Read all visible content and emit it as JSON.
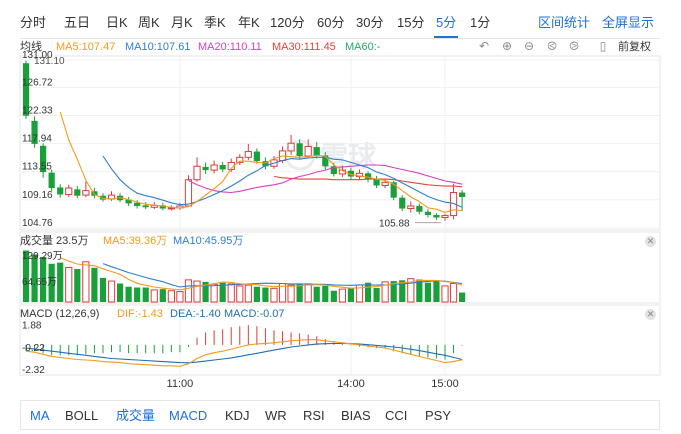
{
  "tabs": [
    "分时",
    "五日",
    "日K",
    "周K",
    "月K",
    "季K",
    "年K",
    "120分",
    "60分",
    "30分",
    "15分",
    "5分",
    "1分"
  ],
  "active_tab": "5分",
  "tools": {
    "range_stats": "区间统计",
    "fullscreen": "全屏显示"
  },
  "ma_legend": {
    "name": "均线",
    "ma5": "MA5:107.47",
    "ma10": "MA10:107.61",
    "ma20": "MA20:110.11",
    "ma30": "MA30:111.45",
    "ma60": "MA60:-"
  },
  "restore_label": "前复权",
  "watermark": "雪球",
  "colors": {
    "up": "#e23a3a",
    "down": "#1aa03a",
    "ma5": "#f29b1b",
    "ma10": "#2f7fcf",
    "ma20": "#d93cc7",
    "ma30": "#e6433b",
    "ma60": "#28a86a",
    "accent": "#1e6fd9",
    "dif": "#f29b1b",
    "dea": "#1f6fb7"
  },
  "chart_data": [
    {
      "type": "candlestick",
      "name": "price",
      "y_ticks": [
        "131.00",
        "126.72",
        "122.33",
        "117.94",
        "113.55",
        "109.16",
        "104.76"
      ],
      "y_tick_values": [
        131.0,
        126.72,
        122.33,
        117.94,
        113.55,
        109.16,
        104.76
      ],
      "ylim": [
        104.76,
        131.0
      ],
      "low_label": "105.88",
      "high_label_overlay": "131.10",
      "candles": [
        [
          130.5,
          122.3,
          130.9,
          121.8
        ],
        [
          121.5,
          117.9,
          122.2,
          117.3
        ],
        [
          117.6,
          113.5,
          118.0,
          112.6
        ],
        [
          113.4,
          111.0,
          113.9,
          110.5
        ],
        [
          111.1,
          110.0,
          111.6,
          109.5
        ],
        [
          110.0,
          111.0,
          111.5,
          109.6
        ],
        [
          110.8,
          109.8,
          111.3,
          109.4
        ],
        [
          109.9,
          110.6,
          112.0,
          109.6
        ],
        [
          110.5,
          109.8,
          111.0,
          109.4
        ],
        [
          109.8,
          109.2,
          110.2,
          108.9
        ],
        [
          109.3,
          109.9,
          110.5,
          109.0
        ],
        [
          109.8,
          109.1,
          110.2,
          108.8
        ],
        [
          109.2,
          108.6,
          109.6,
          108.2
        ],
        [
          108.7,
          108.2,
          109.1,
          107.8
        ],
        [
          108.3,
          108.0,
          108.8,
          107.7
        ],
        [
          108.0,
          108.3,
          108.8,
          107.7
        ],
        [
          108.3,
          107.8,
          108.7,
          107.5
        ],
        [
          107.9,
          107.9,
          108.3,
          107.5
        ],
        [
          107.9,
          108.2,
          108.7,
          107.6
        ],
        [
          108.2,
          112.3,
          113.0,
          108.0
        ],
        [
          112.3,
          114.4,
          115.8,
          112.0
        ],
        [
          114.3,
          113.8,
          115.0,
          113.2
        ],
        [
          113.8,
          114.6,
          115.3,
          113.3
        ],
        [
          114.6,
          113.9,
          115.1,
          113.5
        ],
        [
          113.9,
          115.0,
          115.6,
          113.5
        ],
        [
          115.0,
          115.8,
          116.3,
          114.6
        ],
        [
          115.8,
          116.7,
          117.9,
          115.4
        ],
        [
          116.7,
          115.2,
          117.2,
          114.8
        ],
        [
          115.2,
          114.4,
          115.8,
          113.9
        ],
        [
          114.4,
          115.4,
          116.0,
          114.0
        ],
        [
          115.3,
          116.8,
          117.5,
          114.9
        ],
        [
          116.8,
          118.0,
          119.3,
          116.2
        ],
        [
          118.0,
          116.0,
          118.6,
          115.5
        ],
        [
          116.0,
          117.5,
          118.6,
          115.7
        ],
        [
          117.4,
          116.1,
          118.2,
          115.6
        ],
        [
          116.1,
          114.4,
          116.6,
          113.9
        ],
        [
          114.4,
          113.2,
          114.9,
          112.8
        ],
        [
          113.2,
          113.8,
          114.5,
          112.7
        ],
        [
          113.7,
          112.8,
          114.2,
          112.4
        ],
        [
          112.8,
          113.3,
          113.9,
          112.3
        ],
        [
          113.3,
          112.4,
          113.6,
          111.9
        ],
        [
          112.4,
          111.4,
          112.9,
          111.0
        ],
        [
          111.4,
          111.9,
          112.5,
          111.0
        ],
        [
          111.9,
          109.5,
          112.1,
          109.1
        ],
        [
          109.5,
          107.8,
          109.9,
          107.4
        ],
        [
          107.8,
          108.2,
          108.9,
          107.2
        ],
        [
          108.2,
          107.3,
          108.6,
          106.9
        ],
        [
          107.3,
          106.8,
          107.7,
          106.4
        ],
        [
          106.8,
          106.4,
          107.1,
          106.0
        ],
        [
          106.4,
          106.7,
          107.0,
          105.9
        ],
        [
          106.7,
          110.3,
          111.7,
          106.1
        ],
        [
          110.3,
          109.6,
          110.7,
          107.4
        ]
      ],
      "ma5": [
        null,
        null,
        null,
        null,
        122.9,
        118.5,
        115.5,
        112.2,
        110.0,
        109.4,
        109.3,
        109.5,
        109.2,
        108.8,
        108.5,
        108.3,
        108.2,
        108.0,
        107.9,
        108.1,
        108.9,
        109.9,
        110.9,
        112.0,
        114.1,
        115.2,
        115.2,
        115.0,
        114.9,
        115.6,
        116.0,
        115.9,
        115.8,
        115.9,
        116.1,
        116.0,
        114.6,
        113.7,
        113.1,
        112.9,
        112.7,
        112.4,
        112.2,
        111.6,
        110.6,
        109.6,
        108.9,
        107.9,
        107.7,
        107.2,
        107.6,
        107.5
      ],
      "ma10": [
        null,
        null,
        null,
        null,
        null,
        null,
        null,
        null,
        null,
        116.0,
        114.0,
        112.3,
        111.1,
        110.2,
        109.8,
        109.5,
        109.1,
        108.7,
        108.4,
        108.5,
        108.9,
        109.4,
        110.0,
        110.6,
        111.3,
        112.1,
        113.0,
        113.7,
        114.5,
        114.9,
        115.3,
        115.6,
        115.5,
        115.7,
        115.8,
        115.8,
        115.5,
        115.4,
        115.0,
        114.6,
        114.2,
        113.5,
        113.1,
        112.5,
        111.8,
        111.1,
        110.4,
        109.7,
        109.2,
        108.8,
        108.6,
        108.0
      ],
      "ma20": [
        null,
        null,
        null,
        null,
        null,
        null,
        null,
        null,
        null,
        null,
        null,
        null,
        null,
        null,
        null,
        null,
        null,
        null,
        null,
        112.2,
        111.5,
        111.0,
        110.6,
        110.4,
        110.3,
        110.5,
        110.8,
        111.1,
        111.3,
        111.5,
        111.8,
        112.4,
        112.8,
        113.1,
        113.5,
        113.8,
        114.2,
        114.3,
        114.4,
        114.5,
        114.6,
        114.6,
        114.5,
        114.2,
        113.9,
        113.6,
        113.3,
        112.9,
        112.5,
        112.1,
        111.9,
        111.6
      ],
      "ma30": [
        null,
        null,
        null,
        null,
        null,
        null,
        null,
        null,
        null,
        null,
        null,
        null,
        null,
        null,
        null,
        null,
        null,
        null,
        null,
        null,
        null,
        null,
        null,
        null,
        null,
        null,
        null,
        null,
        null,
        112.8,
        112.6,
        112.5,
        112.4,
        112.4,
        112.4,
        112.4,
        112.3,
        112.3,
        112.3,
        112.3,
        112.4,
        112.4,
        112.4,
        112.3,
        112.1,
        111.9,
        111.7,
        111.5,
        111.4,
        111.3,
        111.3,
        111.2
      ]
    },
    {
      "type": "bar",
      "name": "volume",
      "label": "成交量 23.5万",
      "ma5_label": "MA5:39.36万",
      "ma10_label": "MA10:45.95万",
      "y_ticks": [
        "129.29万",
        "64.65万"
      ],
      "ylim": [
        0,
        129.29
      ],
      "values": [
        128,
        118,
        112,
        95,
        98,
        86,
        82,
        100,
        85,
        60,
        52,
        46,
        38,
        36,
        36,
        30,
        32,
        28,
        26,
        55,
        52,
        50,
        44,
        48,
        45,
        40,
        42,
        38,
        36,
        34,
        46,
        42,
        44,
        45,
        38,
        40,
        28,
        32,
        34,
        42,
        48,
        35,
        50,
        52,
        54,
        58,
        56,
        48,
        52,
        40,
        46,
        23.5
      ],
      "ma5": [
        null,
        null,
        null,
        null,
        110.2,
        101.8,
        94.6,
        92.2,
        90.2,
        82.6,
        75.8,
        68.6,
        56.2,
        46.4,
        41.6,
        37.2,
        34.4,
        32.4,
        30.4,
        34.2,
        38.6,
        42.2,
        45.4,
        49.8,
        48.8,
        45.4,
        43.8,
        43.0,
        40.2,
        38.0,
        39.2,
        39.2,
        40.4,
        42.2,
        43.0,
        41.8,
        39.0,
        36.6,
        34.4,
        35.2,
        36.8,
        38.2,
        41.8,
        45.4,
        47.8,
        49.8,
        54.0,
        53.6,
        53.6,
        50.8,
        48.4,
        41.9
      ],
      "ma10": [
        null,
        null,
        null,
        null,
        null,
        null,
        null,
        null,
        null,
        95.4,
        87.8,
        80.6,
        73.2,
        67.2,
        61.0,
        55.4,
        50.4,
        43.2,
        37.4,
        40.1,
        40.3,
        40.4,
        40.6,
        41.8,
        42.7,
        43.7,
        44.7,
        45.7,
        46.7,
        46.5,
        45.9,
        45.1,
        45.1,
        44.8,
        44.1,
        43.9,
        42.5,
        41.8,
        41.6,
        42.4,
        42.6,
        41.9,
        42.5,
        43.4,
        45.0,
        46.8,
        49.6,
        51.2,
        53.0,
        51.6,
        48.8,
        46.0
      ]
    },
    {
      "type": "macd",
      "name": "macd",
      "label": "MACD (12,26,9)",
      "dif_label": "DIF:-1.43",
      "dea_label": "DEA:-1.40",
      "macd_label": "MACD:-0.07",
      "y_ticks": [
        "1.88",
        "-0.22",
        "-2.32"
      ],
      "ylim": [
        -2.6,
        2.2
      ],
      "dif": [
        -0.6,
        -0.7,
        -0.9,
        -1.1,
        -1.2,
        -1.3,
        -1.4,
        -1.45,
        -1.5,
        -1.6,
        -1.65,
        -1.7,
        -1.8,
        -1.85,
        -1.9,
        -1.95,
        -2.0,
        -2.0,
        -2.05,
        -1.8,
        -1.3,
        -0.95,
        -0.75,
        -0.6,
        -0.4,
        -0.2,
        0.0,
        0.1,
        0.15,
        0.2,
        0.3,
        0.4,
        0.45,
        0.5,
        0.5,
        0.4,
        0.3,
        0.2,
        0.1,
        0.0,
        -0.1,
        -0.2,
        -0.3,
        -0.5,
        -0.7,
        -0.9,
        -1.1,
        -1.3,
        -1.5,
        -1.7,
        -1.6,
        -1.43
      ],
      "dea": [
        -0.3,
        -0.4,
        -0.5,
        -0.6,
        -0.7,
        -0.8,
        -0.9,
        -1.0,
        -1.1,
        -1.2,
        -1.3,
        -1.35,
        -1.4,
        -1.45,
        -1.5,
        -1.55,
        -1.6,
        -1.65,
        -1.7,
        -1.72,
        -1.65,
        -1.55,
        -1.45,
        -1.35,
        -1.25,
        -1.1,
        -0.95,
        -0.8,
        -0.65,
        -0.5,
        -0.35,
        -0.2,
        -0.1,
        0.0,
        0.08,
        0.12,
        0.14,
        0.14,
        0.12,
        0.08,
        0.02,
        -0.05,
        -0.12,
        -0.2,
        -0.3,
        -0.42,
        -0.55,
        -0.7,
        -0.85,
        -1.0,
        -1.2,
        -1.4
      ],
      "hist": [
        -0.6,
        -0.6,
        -0.8,
        -1.0,
        -1.0,
        -1.0,
        -1.0,
        -0.9,
        -0.8,
        -0.8,
        -0.7,
        -0.7,
        -0.8,
        -0.8,
        -0.8,
        -0.8,
        -0.8,
        -0.7,
        -0.7,
        -0.2,
        0.7,
        1.2,
        1.4,
        1.5,
        1.7,
        1.8,
        1.9,
        1.8,
        1.6,
        1.4,
        1.3,
        1.2,
        1.1,
        1.0,
        0.84,
        0.56,
        0.32,
        0.12,
        -0.04,
        -0.16,
        -0.24,
        -0.3,
        -0.36,
        -0.6,
        -0.8,
        -0.96,
        -1.1,
        -1.2,
        -1.3,
        -1.4,
        -0.8,
        -0.07
      ],
      "x_ticks": [
        "11:00",
        "14:00",
        "15:00"
      ],
      "x_tick_index": [
        18,
        38,
        49
      ]
    }
  ],
  "indicators": [
    "MA",
    "BOLL",
    "成交量",
    "MACD",
    "KDJ",
    "WR",
    "RSI",
    "BIAS",
    "CCI",
    "PSY"
  ],
  "active_indicators": [
    "MA",
    "成交量",
    "MACD"
  ]
}
